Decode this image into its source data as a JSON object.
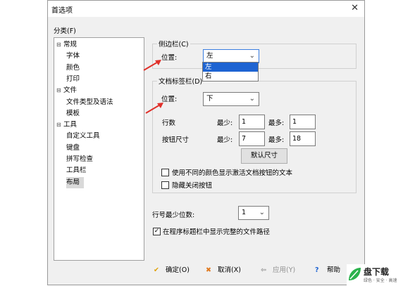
{
  "window": {
    "title": "首选项",
    "close_glyph": "✕"
  },
  "category": {
    "label": "分类(F)",
    "items": [
      {
        "label": "常规",
        "level": 0,
        "expander": "▢"
      },
      {
        "label": "字体",
        "level": 1
      },
      {
        "label": "颜色",
        "level": 1
      },
      {
        "label": "打印",
        "level": 1
      },
      {
        "label": "文件",
        "level": 0,
        "expander": "▢"
      },
      {
        "label": "文件类型及语法",
        "level": 1
      },
      {
        "label": "模板",
        "level": 1
      },
      {
        "label": "工具",
        "level": 0,
        "expander": "▢"
      },
      {
        "label": "自定义工具",
        "level": 1
      },
      {
        "label": "键盘",
        "level": 1
      },
      {
        "label": "拼写检查",
        "level": 1
      },
      {
        "label": "工具栏",
        "level": 1
      },
      {
        "label": "布局",
        "level": 1,
        "selected": true
      }
    ]
  },
  "sidebar_group": {
    "title": "侧边栏(C)",
    "position_label": "位置:",
    "position_value": "左",
    "options": [
      "左",
      "右"
    ]
  },
  "tabs_group": {
    "title": "文档标签栏(D)",
    "position_label": "位置:",
    "position_value": "下",
    "rows_label": "行数",
    "min_label": "最少:",
    "max_label": "最多:",
    "rows_min": "1",
    "rows_max": "1",
    "btnsize_label": "按钮尺寸",
    "btn_min": "7",
    "btn_max": "18",
    "default_size_button": "默认尺寸",
    "check_colors": "使用不同的颜色显示激活文档按钮的文本",
    "check_hide_close": "隐藏关闭按钮"
  },
  "line_number": {
    "label": "行号最少位数:",
    "value": "1"
  },
  "show_full_path": {
    "label": "在程序标题栏中显示完整的文件路径",
    "checked": true
  },
  "buttons": {
    "ok": "确定(O)",
    "cancel": "取消(X)",
    "apply": "应用(Y)",
    "help": "帮助"
  },
  "watermark": {
    "text": "盘下载",
    "sub": "绿色 · 安全 · 高速"
  },
  "colors": {
    "accent": "#1e64d2",
    "arrow": "#e0302a",
    "ok_check": "#e0a000",
    "cancel_x": "#e07a20"
  }
}
